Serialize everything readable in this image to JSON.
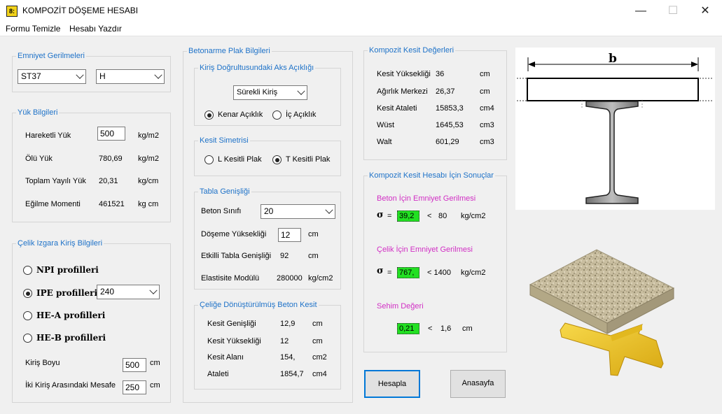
{
  "window": {
    "title": "KOMPOZİT DÖŞEME HESABI",
    "minimize": "—",
    "maximize": "☐",
    "close": "✕",
    "icon_glyph": "8:"
  },
  "menu": {
    "clear": "Formu Temizle",
    "print": "Hesabı Yazdır"
  },
  "emniyet": {
    "legend": "Emniyet Gerilmeleri",
    "steel": "ST37",
    "load_case": "H"
  },
  "yuk": {
    "legend": "Yük Bilgileri",
    "moving_label": "Hareketli Yük",
    "moving_value": "500",
    "moving_unit": "kg/m2",
    "dead_label": "Ölü  Yük",
    "dead_value": "780,69",
    "dead_unit": "kg/m2",
    "total_label": "Toplam Yayılı  Yük",
    "total_value": "20,31",
    "total_unit": "kg/cm",
    "moment_label": "Eğilme Momenti",
    "moment_value": "461521",
    "moment_unit": "kg cm"
  },
  "celik": {
    "legend": "Çelik Izgara Kiriş Bilgileri",
    "npi": "NPI profilleri",
    "ipe": "IPE profilleri",
    "ipe_value": "240",
    "hea": "HE-A profilleri",
    "heb": "HE-B profilleri",
    "length_label": "Kiriş Boyu",
    "length_value": "500",
    "length_unit": "cm",
    "spacing_label": "İki Kiriş Arasındaki Mesafe",
    "spacing_value": "250",
    "spacing_unit": "cm"
  },
  "betonarme": {
    "legend": "Betonarme Plak Bilgileri",
    "aks": {
      "legend": "Kiriş Doğrultusundaki Aks Açıklığı",
      "type": "Sürekli Kiriş",
      "edge": "Kenar Açıklık",
      "inner": "İç Açıklık"
    },
    "simetri": {
      "legend": "Kesit Simetrisi",
      "l": "L Kesitli Plak",
      "t": "T Kesitli Plak"
    },
    "tabla": {
      "legend": "Tabla Genişliği",
      "class_label": "Beton Sınıfı",
      "class_value": "20",
      "height_label": "Döşeme Yüksekliği",
      "height_value": "12",
      "height_unit": "cm",
      "eff_label": "Etkilli Tabla Genişliği",
      "eff_value": "92",
      "eff_unit": "cm",
      "e_label": "Elastisite Modülü",
      "e_value": "280000",
      "e_unit": "kg/cm2"
    },
    "donusum": {
      "legend": "Çeliğe Dönüştürülmüş Beton Kesit",
      "rows": [
        {
          "label": "Kesit Genişliği",
          "value": "12,9",
          "unit": "cm"
        },
        {
          "label": "Kesit Yüksekliği",
          "value": "12",
          "unit": "cm"
        },
        {
          "label": "Kesit Alanı",
          "value": "154,",
          "unit": "cm2"
        },
        {
          "label": "Ataleti",
          "value": "1854,7",
          "unit": "cm4"
        }
      ]
    }
  },
  "kompozit": {
    "legend": "Kompozit Kesit Değerleri",
    "rows": [
      {
        "label": "Kesit Yüksekliği",
        "value": "36",
        "unit": "cm"
      },
      {
        "label": "Ağırlık Merkezi",
        "value": "26,37",
        "unit": "cm"
      },
      {
        "label": "Kesit Ataleti",
        "value": "15853,3",
        "unit": "cm4"
      },
      {
        "label": "Wüst",
        "value": "1645,53",
        "unit": "cm3"
      },
      {
        "label": "Walt",
        "value": "601,29",
        "unit": "cm3"
      }
    ]
  },
  "sonuclar": {
    "legend": "Kompozit Kesit Hesabı İçin Sonuçlar",
    "beton_title": "Beton İçin Emniyet Gerilmesi",
    "beton_sigma": "σ",
    "beton_eq": "=",
    "beton_value": "39,2",
    "beton_lt": "<",
    "beton_limit": "80",
    "beton_unit": "kg/cm2",
    "celik_title": "Çelik İçin Emniyet Gerilmesi",
    "celik_sigma": "σ",
    "celik_eq": "=",
    "celik_value": "767,",
    "celik_lt": "< 1400",
    "celik_unit": "kg/cm2",
    "sehim_title": "Sehim Değeri",
    "sehim_value": "0,21",
    "sehim_lt": "<",
    "sehim_limit": "1,6",
    "sehim_unit": "cm"
  },
  "buttons": {
    "calc": "Hesapla",
    "home": "Anasayfa"
  },
  "diagram": {
    "b_label": "b"
  }
}
